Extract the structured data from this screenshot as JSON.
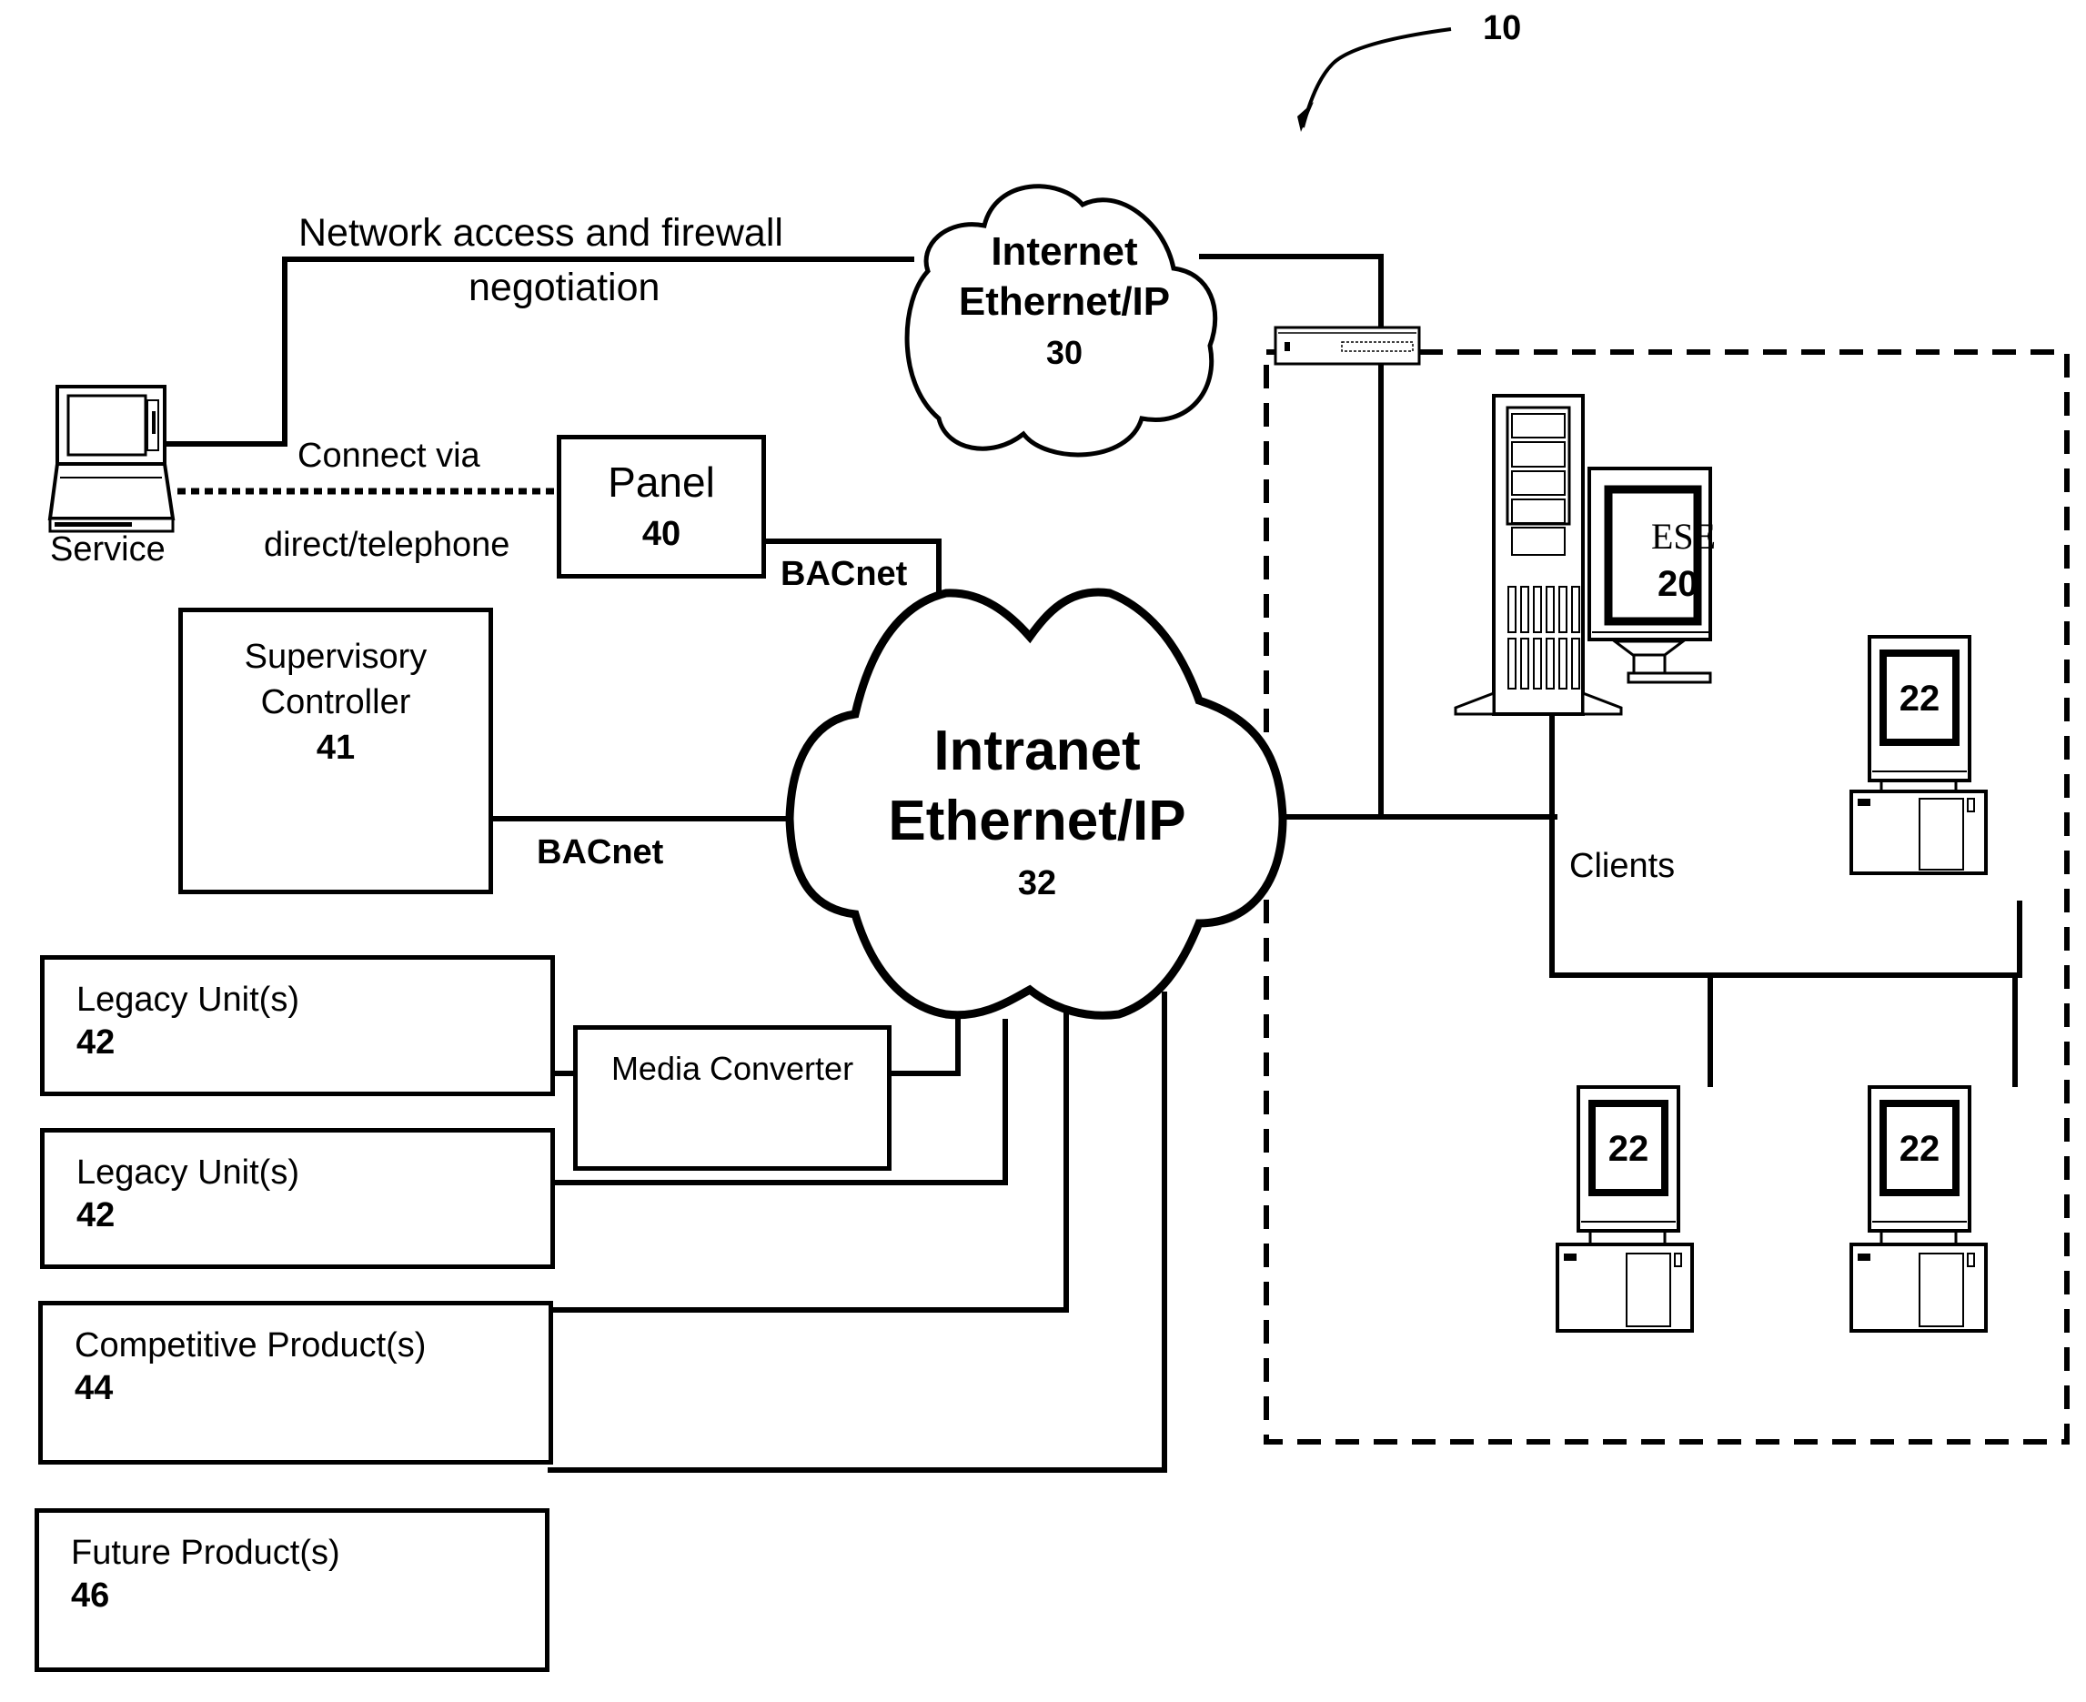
{
  "figure": {
    "reference_numeral": "10",
    "ink_color": "#000000",
    "background_color": "#ffffff"
  },
  "internet_cloud": {
    "line1": "Internet",
    "line2": "Ethernet/IP",
    "numeral": "30"
  },
  "intranet_cloud": {
    "line1": "Intranet",
    "line2": "Ethernet/IP",
    "numeral": "32"
  },
  "service": {
    "label": "Service",
    "link_label_line1": "Network access and firewall",
    "link_label_line2": "negotiation",
    "dial_label_line1": "Connect via",
    "dial_label_line2": "direct/telephone"
  },
  "panel": {
    "title": "Panel",
    "numeral": "40",
    "link_label": "BACnet"
  },
  "supervisory_controller": {
    "line1": "Supervisory",
    "line2": "Controller",
    "numeral": "41",
    "link_label": "BACnet"
  },
  "media_converter": {
    "label": "Media Converter"
  },
  "devices": [
    {
      "title": "Legacy Unit(s)",
      "numeral": "42"
    },
    {
      "title": "Legacy Unit(s)",
      "numeral": "42"
    },
    {
      "title": "Competitive Product(s)",
      "numeral": "44"
    },
    {
      "title": "Future Product(s)",
      "numeral": "46"
    }
  ],
  "enterprise": {
    "server_label": "ESE",
    "server_numeral": "20",
    "clients_label": "Clients",
    "clients": [
      {
        "numeral": "22"
      },
      {
        "numeral": "22"
      },
      {
        "numeral": "22"
      }
    ]
  }
}
